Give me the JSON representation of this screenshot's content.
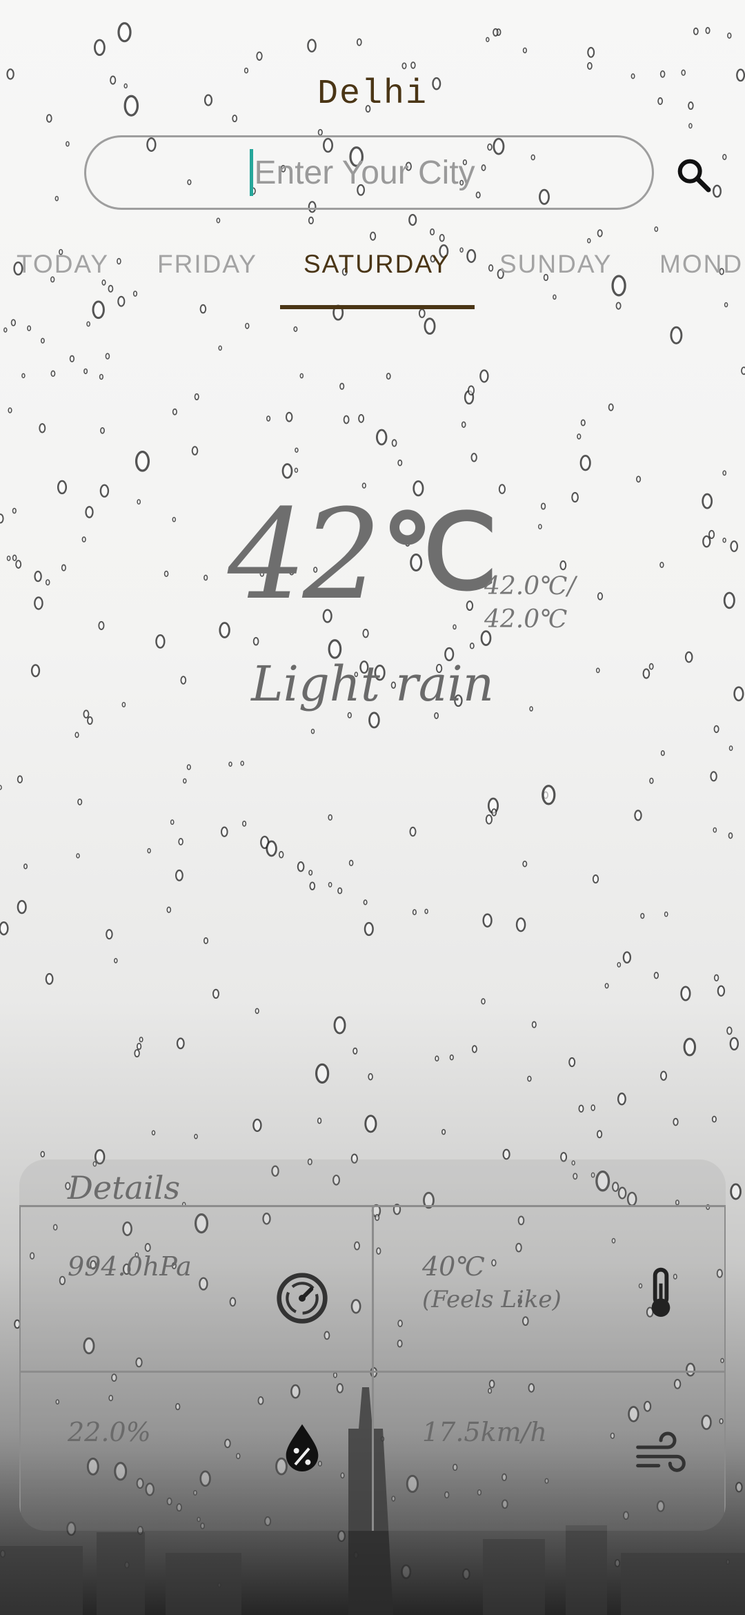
{
  "city": "Delhi",
  "search": {
    "placeholder": "Enter Your City"
  },
  "tabs": [
    {
      "label": "TODAY"
    },
    {
      "label": "FRIDAY"
    },
    {
      "label": "SATURDAY"
    },
    {
      "label": "SUNDAY"
    },
    {
      "label": "MOND"
    }
  ],
  "weather": {
    "temp": "42",
    "unit": "℃",
    "minmax_line1": "42.0℃/",
    "minmax_line2": "42.0℃",
    "condition": "Light rain"
  },
  "details": {
    "title": "Details",
    "pressure": "994.0hPa",
    "feels_like": "40℃",
    "feels_like_label": "(Feels Like)",
    "humidity": "22.0%",
    "wind": "17.5km/h"
  },
  "icons": {
    "search": "search-icon",
    "pressure": "gauge-icon",
    "feels_like": "thermometer-icon",
    "humidity": "humidity-drop-icon",
    "wind": "wind-icon"
  },
  "colors": {
    "accent": "#4a3515",
    "caret": "#26a69a",
    "inactive_tab": "#a3a3a3",
    "text_gray": "#6e6e6e"
  }
}
